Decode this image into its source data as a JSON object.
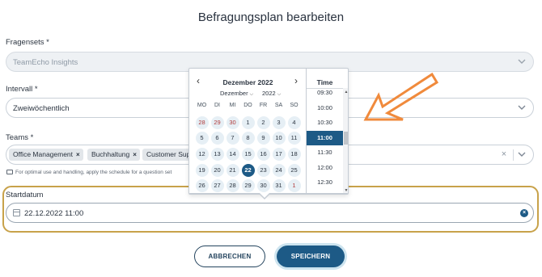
{
  "title": "Befragungsplan bearbeiten",
  "fragensets": {
    "label": "Fragensets *",
    "value": "TeamEcho Insights"
  },
  "intervall": {
    "label": "Intervall *",
    "value": "Zweiwöchentlich"
  },
  "teams": {
    "label": "Teams *",
    "chips": [
      "Office Management",
      "Buchhaltung",
      "Customer Sup"
    ],
    "hint": "For optimal use and handling, apply the schedule for a question set"
  },
  "startdatum": {
    "label": "Startdatum",
    "value": "22.12.2022 11:00"
  },
  "buttons": {
    "cancel": "ABBRECHEN",
    "save": "SPEICHERN"
  },
  "datepicker": {
    "month_title": "Dezember 2022",
    "month_select": "Dezember",
    "year_select": "2022",
    "prev_icon": "‹",
    "next_icon": "›",
    "weekdays": [
      "MO",
      "DI",
      "MI",
      "DO",
      "FR",
      "SA",
      "SO"
    ],
    "weeks": [
      [
        "28",
        "29",
        "30",
        "1",
        "2",
        "3",
        "4"
      ],
      [
        "5",
        "6",
        "7",
        "8",
        "9",
        "10",
        "11"
      ],
      [
        "12",
        "13",
        "14",
        "15",
        "16",
        "17",
        "18"
      ],
      [
        "19",
        "20",
        "21",
        "22",
        "23",
        "24",
        "25"
      ],
      [
        "26",
        "27",
        "28",
        "29",
        "30",
        "31",
        "1"
      ]
    ],
    "outside_days": [
      [
        0,
        0
      ],
      [
        0,
        1
      ],
      [
        0,
        2
      ],
      [
        4,
        6
      ]
    ],
    "selected_day": [
      3,
      3
    ],
    "time_header": "Time",
    "times": [
      "09:30",
      "10:00",
      "10:30",
      "11:00",
      "11:30",
      "12:00",
      "12:30"
    ],
    "selected_time": "11:00"
  },
  "colors": {
    "accent": "#1d5a86",
    "highlight_border": "#c8a24a",
    "arrow": "#f08a3c",
    "chip_bg": "#e2e6ea"
  },
  "icons": {
    "chevron": "chevron-down-icon",
    "clear": "close-icon",
    "calendar": "calendar-icon",
    "info": "info-icon",
    "arrow": "pointer-arrow-icon"
  }
}
